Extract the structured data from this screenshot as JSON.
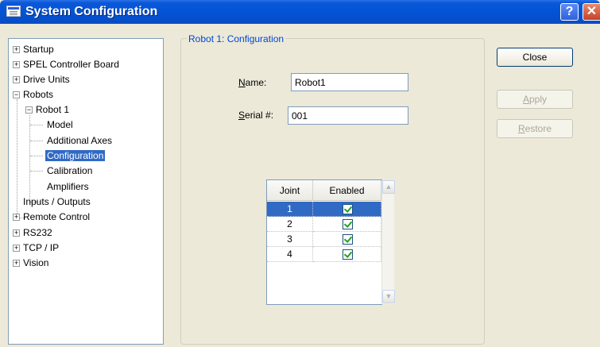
{
  "window": {
    "title": "System Configuration",
    "help_label": "?",
    "close_label": "✕"
  },
  "tree": {
    "startup": "Startup",
    "controller_board": "SPEL Controller Board",
    "drive_units": "Drive Units",
    "robots": "Robots",
    "robot1": "Robot 1",
    "model": "Model",
    "additional_axes": "Additional Axes",
    "configuration": "Configuration",
    "calibration": "Calibration",
    "amplifiers": "Amplifiers",
    "inputs_outputs": "Inputs / Outputs",
    "remote_control": "Remote Control",
    "rs232": "RS232",
    "tcpip": "TCP / IP",
    "vision": "Vision"
  },
  "group": {
    "title": "Robot 1: Configuration"
  },
  "form": {
    "name_label_first": "N",
    "name_label_rest": "ame:",
    "name_value": "Robot1",
    "serial_label_first": "S",
    "serial_label_rest": "erial #:",
    "serial_value": "001"
  },
  "grid": {
    "columns": [
      "Joint",
      "Enabled"
    ],
    "rows": [
      {
        "joint": "1",
        "enabled": true
      },
      {
        "joint": "2",
        "enabled": true
      },
      {
        "joint": "3",
        "enabled": true
      },
      {
        "joint": "4",
        "enabled": true
      }
    ]
  },
  "buttons": {
    "close": "Close",
    "apply_first": "A",
    "apply_rest": "pply",
    "restore_first": "R",
    "restore_rest": "estore"
  },
  "colors": {
    "titlebar": "#0454d6",
    "selection": "#316ac5",
    "group_label": "#0046d5"
  }
}
